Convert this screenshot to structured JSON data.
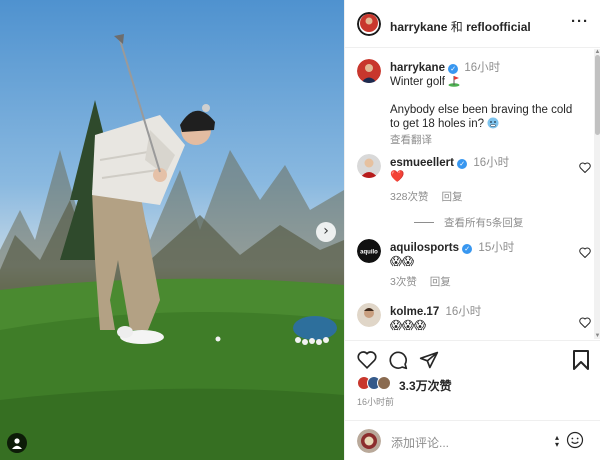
{
  "post": {
    "header_user": "harrykane",
    "header_and": "和",
    "header_collab": "refloofficial",
    "more_icon": "more-icon"
  },
  "caption": {
    "username": "harrykane",
    "time": "16小时",
    "line1": "Winter golf ",
    "line2": "Anybody else been braving the cold to get 18 holes in? ",
    "translate": "查看翻译"
  },
  "comments": [
    {
      "username": "esmueellert",
      "time": "16小时",
      "text": "❤️",
      "likes": "328次赞",
      "reply": "回复",
      "view_replies": "查看所有5条回复"
    },
    {
      "username": "aquilosports",
      "time": "15小时",
      "text": "😱😱",
      "likes": "3次赞",
      "reply": "回复"
    },
    {
      "username": "kolme.17",
      "time": "16小时",
      "text": "😱😱😱"
    }
  ],
  "actions": {
    "likes_count": "3.3万次赞",
    "post_time": "16小时前"
  },
  "add_comment": {
    "placeholder": "添加评论..."
  },
  "colors": {
    "verified": "#3897f0",
    "heart": "#ed4956",
    "muted": "#8e8e8e"
  }
}
